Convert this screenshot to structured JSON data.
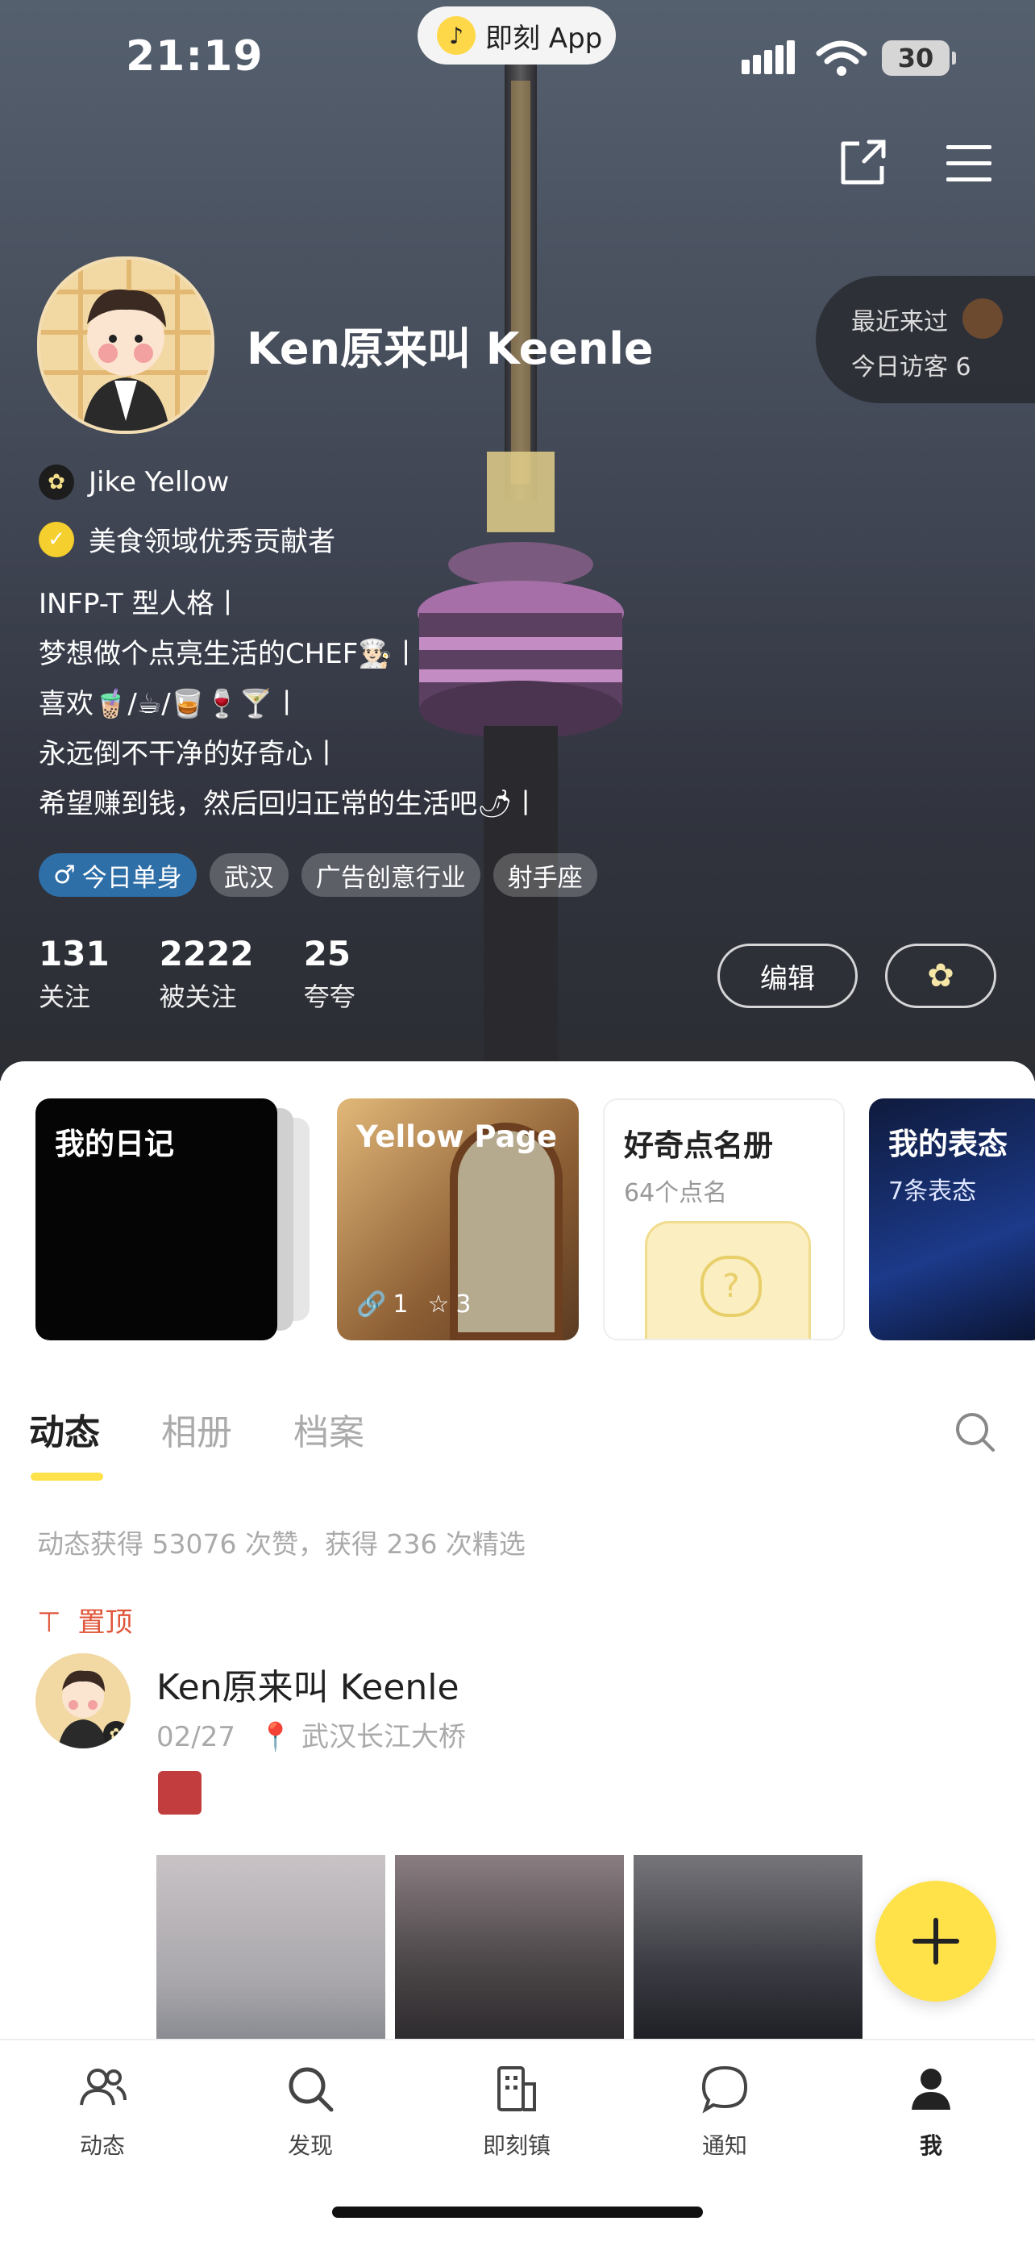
{
  "status_bar": {
    "time": "21:19",
    "app_pill": "即刻 App",
    "battery": "30"
  },
  "profile": {
    "name": "Ken原来叫 Keenle",
    "visit": {
      "recent": "最近来过",
      "today": "今日访客 6"
    },
    "badges": [
      "Jike Yellow",
      "美食领域优秀贡献者"
    ],
    "bio": [
      "INFP-T 型人格丨",
      "梦想做个点亮生活的CHEF👨🏻‍🍳丨",
      "喜欢🧋/☕/🥃🍷🍸丨",
      "永远倒不干净的好奇心丨",
      "希望赚到钱，然后回归正常的生活吧🌶丨"
    ],
    "tags": [
      "今日单身",
      "武汉",
      "广告创意行业",
      "射手座"
    ],
    "stats": [
      {
        "value": "131",
        "label": "关注"
      },
      {
        "value": "2222",
        "label": "被关注"
      },
      {
        "value": "25",
        "label": "夸夸"
      }
    ],
    "edit_label": "编辑"
  },
  "cards": [
    {
      "title": "我的日记"
    },
    {
      "title": "Yellow Page",
      "links": "1",
      "stars": "3"
    },
    {
      "title": "好奇点名册",
      "sub": "64个点名"
    },
    {
      "title": "我的表态",
      "sub": "7条表态"
    }
  ],
  "tabs": [
    "动态",
    "相册",
    "档案"
  ],
  "summary": "动态获得 53076 次赞，获得 236 次精选",
  "pinned_label": "置顶",
  "post": {
    "author": "Ken原来叫 Keenle",
    "date": "02/27",
    "location": "武汉长江大桥"
  },
  "tabbar": [
    {
      "label": "动态",
      "icon": "people-icon"
    },
    {
      "label": "发现",
      "icon": "search-icon"
    },
    {
      "label": "即刻镇",
      "icon": "building-icon"
    },
    {
      "label": "通知",
      "icon": "chat-bubble-icon"
    },
    {
      "label": "我",
      "icon": "person-icon"
    }
  ],
  "colors": {
    "accent": "#ffe24a",
    "pinned": "#e0553a",
    "tag_single": "#2f6fa8"
  }
}
